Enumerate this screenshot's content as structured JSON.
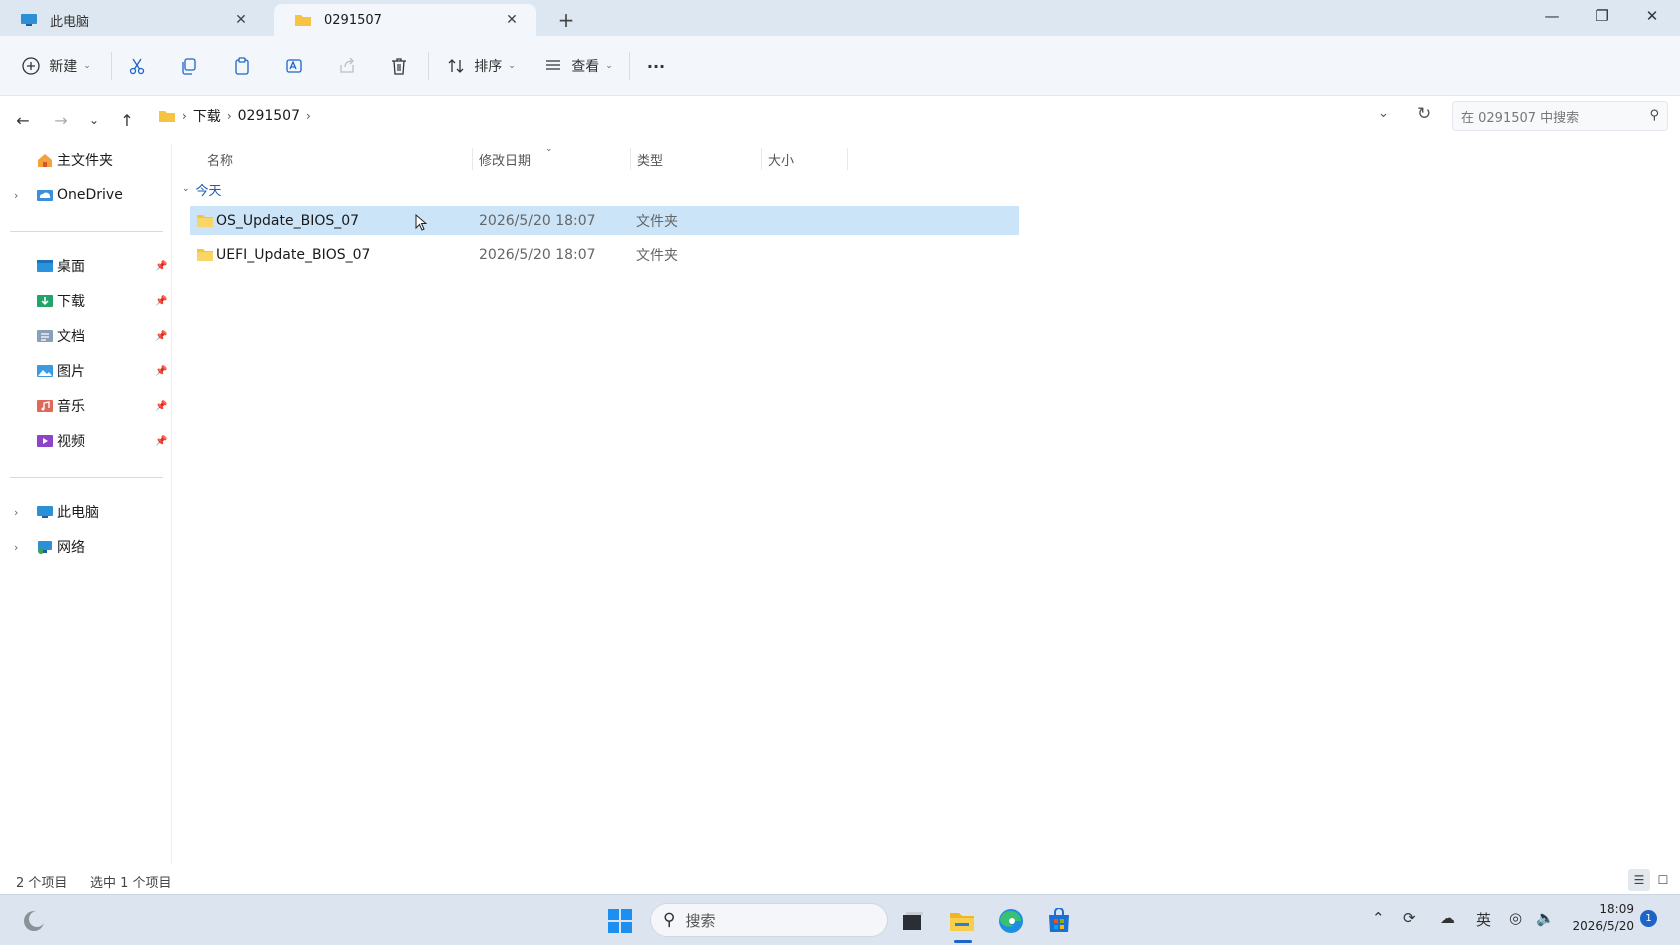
{
  "tabs": [
    {
      "label": "此电脑",
      "icon": "monitor-icon"
    },
    {
      "label": "0291507",
      "icon": "folder-icon"
    }
  ],
  "window_controls": {
    "minimize": "—",
    "restore": "❐",
    "close": "✕"
  },
  "toolbar": {
    "new_label": "新建",
    "sort_label": "排序",
    "view_label": "查看",
    "more_label": "···"
  },
  "address": {
    "crumbs": [
      "下载",
      "0291507"
    ],
    "search_placeholder": "在 0291507 中搜索"
  },
  "sidebar": {
    "home": "主文件夹",
    "onedrive": "OneDrive",
    "pinned": [
      {
        "label": "桌面",
        "icon": "desktop-folder-icon"
      },
      {
        "label": "下载",
        "icon": "downloads-folder-icon"
      },
      {
        "label": "文档",
        "icon": "documents-folder-icon"
      },
      {
        "label": "图片",
        "icon": "pictures-folder-icon"
      },
      {
        "label": "音乐",
        "icon": "music-folder-icon"
      },
      {
        "label": "视频",
        "icon": "videos-folder-icon"
      }
    ],
    "this_pc": "此电脑",
    "network": "网络"
  },
  "columns": {
    "name": "名称",
    "date": "修改日期",
    "type": "类型",
    "size": "大小"
  },
  "group": {
    "label": "今天"
  },
  "files": [
    {
      "name": "OS_Update_BIOS_07",
      "date": "2026/5/20 18:07",
      "type": "文件夹",
      "selected": true
    },
    {
      "name": "UEFI_Update_BIOS_07",
      "date": "2026/5/20 18:07",
      "type": "文件夹",
      "selected": false
    }
  ],
  "status": {
    "count": "2 个项目",
    "selection": "选中 1 个项目"
  },
  "taskbar": {
    "search_label": "搜索",
    "ime": "英",
    "time": "18:09",
    "date": "2026/5/20",
    "notifications": "1"
  },
  "colors": {
    "selection": "#cce4f7",
    "accent": "#1d64c8",
    "folder": "#f6c343",
    "group_header": "#1b5fae"
  }
}
